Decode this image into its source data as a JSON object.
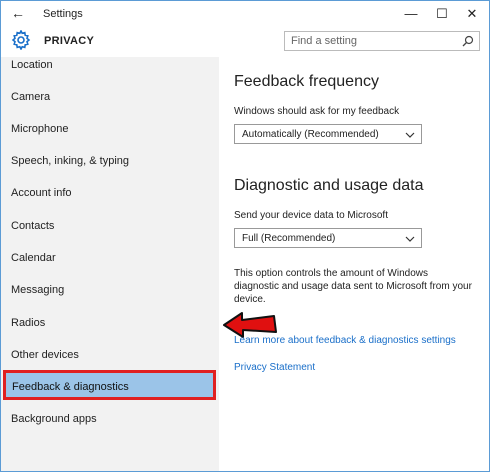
{
  "titlebar": {
    "title": "Settings",
    "back_icon": "←",
    "minimize": "—",
    "maximize": "☐",
    "close": "✕"
  },
  "header": {
    "section_title": "PRIVACY",
    "search_placeholder": "Find a setting"
  },
  "sidebar": {
    "items": [
      {
        "label": "Location"
      },
      {
        "label": "Camera"
      },
      {
        "label": "Microphone"
      },
      {
        "label": "Speech, inking, & typing"
      },
      {
        "label": "Account info"
      },
      {
        "label": "Contacts"
      },
      {
        "label": "Calendar"
      },
      {
        "label": "Messaging"
      },
      {
        "label": "Radios"
      },
      {
        "label": "Other devices"
      },
      {
        "label": "Feedback & diagnostics",
        "selected": true
      },
      {
        "label": "Background apps"
      }
    ]
  },
  "main": {
    "feedback_heading": "Feedback frequency",
    "feedback_label": "Windows should ask for my feedback",
    "feedback_value": "Automatically (Recommended)",
    "diagnostic_heading": "Diagnostic and usage data",
    "diagnostic_label": "Send your device data to Microsoft",
    "diagnostic_value": "Full (Recommended)",
    "description": "This option controls the amount of Windows diagnostic and usage data sent to Microsoft from your device.",
    "learn_more_link": "Learn more about feedback & diagnostics settings",
    "privacy_link": "Privacy Statement"
  },
  "colors": {
    "accent": "#1a6fc9",
    "selection": "#9bc4e8",
    "highlight_border": "#e02020"
  }
}
